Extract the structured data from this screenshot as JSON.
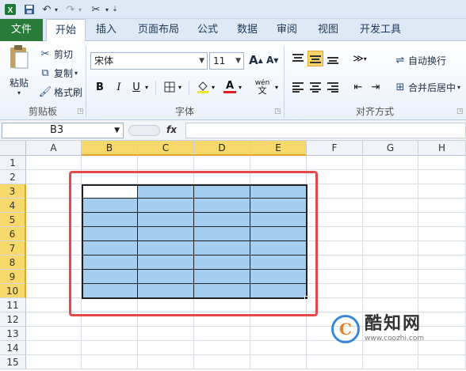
{
  "qat": {
    "save_icon": "save-icon",
    "undo_icon": "undo-icon",
    "redo_icon": "redo-icon",
    "customize_icon": "tool-icon"
  },
  "tabs": [
    {
      "label": "文件"
    },
    {
      "label": "开始"
    },
    {
      "label": "插入"
    },
    {
      "label": "页面布局"
    },
    {
      "label": "公式"
    },
    {
      "label": "数据"
    },
    {
      "label": "审阅"
    },
    {
      "label": "视图"
    },
    {
      "label": "开发工具"
    }
  ],
  "clipboard": {
    "paste": "粘贴",
    "cut": "剪切",
    "copy": "复制",
    "format_painter": "格式刷",
    "group_label": "剪贴板"
  },
  "font": {
    "name": "宋体",
    "size": "11",
    "grow": "A",
    "shrink": "A",
    "bold": "B",
    "italic": "I",
    "underline": "U",
    "phonetic": "wén",
    "group_label": "字体"
  },
  "alignment": {
    "wrap_text": "自动换行",
    "merge_center": "合并后居中",
    "group_label": "对齐方式"
  },
  "formula_bar": {
    "name_box": "B3",
    "fx": "fx",
    "value": ""
  },
  "grid": {
    "columns": [
      "A",
      "B",
      "C",
      "D",
      "E",
      "F",
      "G",
      "H"
    ],
    "selected_columns": [
      "B",
      "C",
      "D",
      "E"
    ],
    "rows": [
      "1",
      "2",
      "3",
      "4",
      "5",
      "6",
      "7",
      "8",
      "9",
      "10",
      "11",
      "12",
      "13",
      "14",
      "15"
    ],
    "selected_rows": [
      "3",
      "4",
      "5",
      "6",
      "7",
      "8",
      "9",
      "10"
    ],
    "active_cell": "B3",
    "selection": "B3:E10",
    "selection_fill": "#a5cdef",
    "highlight_color": "#e04a4a"
  },
  "watermark": {
    "logo_letter": "C",
    "name": "酷知网",
    "url": "www.coozhi.com"
  }
}
